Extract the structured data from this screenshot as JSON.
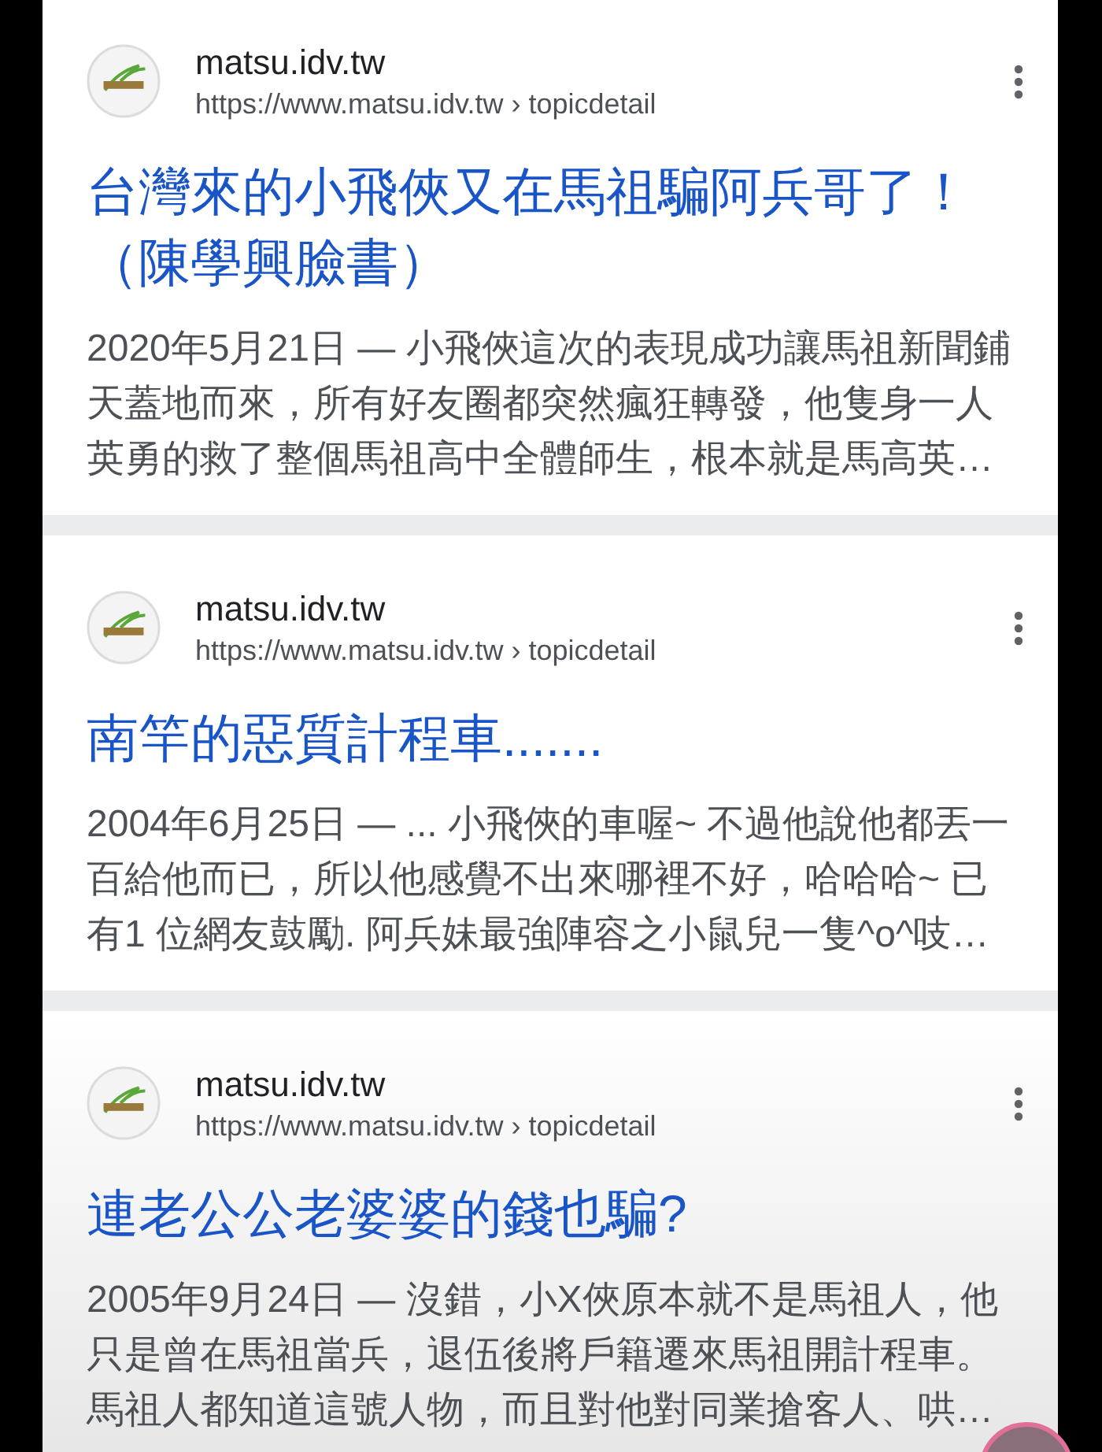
{
  "results": [
    {
      "site_name": "matsu.idv.tw",
      "url": "https://www.matsu.idv.tw",
      "separator": "›",
      "path": "topicdetail",
      "title": "台灣來的小飛俠又在馬祖騙阿兵哥了！（陳學興臉書）",
      "snippet": "2020年5月21日 — 小飛俠這次的表現成功讓馬祖新聞鋪天蓋地而來，所有好友圈都突然瘋狂轉發，他隻身一人英勇的救了整個馬祖高中全體師生，根本就是馬高英…"
    },
    {
      "site_name": "matsu.idv.tw",
      "url": "https://www.matsu.idv.tw",
      "separator": "›",
      "path": "topicdetail",
      "title": "南竿的惡質計程車.......",
      "snippet": "2004年6月25日 — ... 小飛俠的車喔~ 不過他說他都丟一百給他而已，所以他感覺不出來哪裡不好，哈哈哈~ 已有1 位網友鼓勵. 阿兵妹最強陣容之小鼠兒一隻^o^吱…"
    },
    {
      "site_name": "matsu.idv.tw",
      "url": "https://www.matsu.idv.tw",
      "separator": "›",
      "path": "topicdetail",
      "title": "連老公公老婆婆的錢也騙?",
      "snippet": "2005年9月24日 — 沒錯，小X俠原本就不是馬祖人，他只是曾在馬祖當兵，退伍後將戶籍遷來馬祖開計程車。馬祖人都知道這號人物，而且對他對同業搶客人、哄…"
    }
  ]
}
